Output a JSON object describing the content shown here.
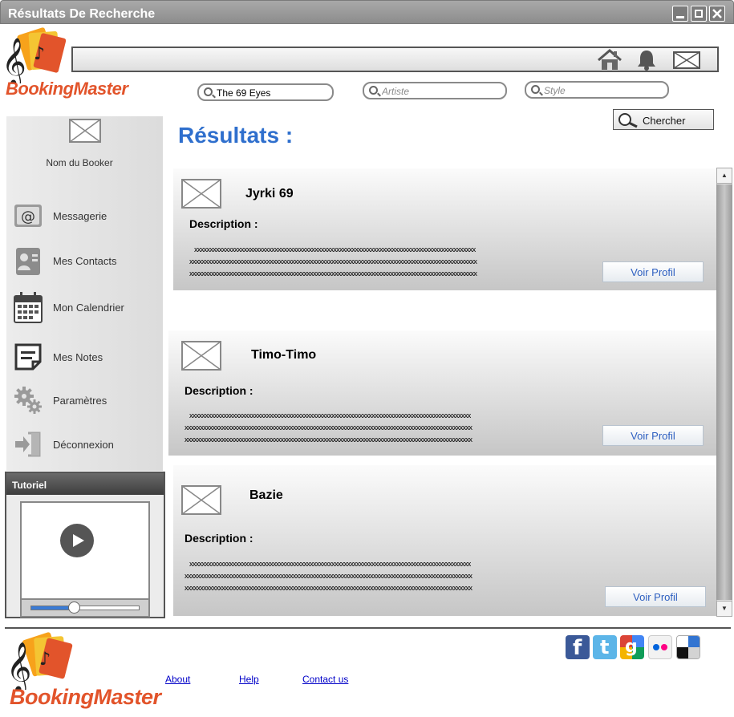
{
  "window": {
    "title": "Résultats De Recherche"
  },
  "logo": {
    "text": "BookingMaster"
  },
  "search": {
    "query_value": "The 69 Eyes",
    "artist_placeholder": "Artiste",
    "style_placeholder": "Style",
    "button_label": "Chercher"
  },
  "sidebar": {
    "booker_name": "Nom du Booker",
    "items": [
      {
        "label": "Messagerie"
      },
      {
        "label": "Mes Contacts"
      },
      {
        "label": "Mon Calendrier"
      },
      {
        "label": "Mes Notes"
      },
      {
        "label": "Paramètres"
      },
      {
        "label": "Déconnexion"
      }
    ]
  },
  "tutorial": {
    "title": "Tutoriel",
    "progress": 0.4
  },
  "results": {
    "title": "Résultats :",
    "items": [
      {
        "name": "Jyrki 69",
        "description_label": "Description :",
        "lines": [
          "xxxxxxxxxxxxxxxxxxxxxxxxxxxxxxxxxxxxxxxxxxxxxxxxxxxxxxxxxxxxxxxxxxxxxxxxxxxxxxxxxxxxxxxxxxx",
          "xxxxxxxxxxxxxxxxxxxxxxxxxxxxxxxxxxxxxxxxxxxxxxxxxxxxxxxxxxxxxxxxxxxxxxxxxxxxxxxxxxxxxxxxxxxxx",
          "xxxxxxxxxxxxxxxxxxxxxxxxxxxxxxxxxxxxxxxxxxxxxxxxxxxxxxxxxxxxxxxxxxxxxxxxxxxxxxxxxxxxxxxxxxxxx"
        ],
        "button_label": "Voir Profil"
      },
      {
        "name": "Timo-Timo",
        "description_label": "Description :",
        "lines": [
          "xxxxxxxxxxxxxxxxxxxxxxxxxxxxxxxxxxxxxxxxxxxxxxxxxxxxxxxxxxxxxxxxxxxxxxxxxxxxxxxxxxxxxxxxxxx",
          "xxxxxxxxxxxxxxxxxxxxxxxxxxxxxxxxxxxxxxxxxxxxxxxxxxxxxxxxxxxxxxxxxxxxxxxxxxxxxxxxxxxxxxxxxxxxx",
          "xxxxxxxxxxxxxxxxxxxxxxxxxxxxxxxxxxxxxxxxxxxxxxxxxxxxxxxxxxxxxxxxxxxxxxxxxxxxxxxxxxxxxxxxxxxxx"
        ],
        "button_label": "Voir Profil"
      },
      {
        "name": "Bazie",
        "description_label": "Description :",
        "lines": [
          "xxxxxxxxxxxxxxxxxxxxxxxxxxxxxxxxxxxxxxxxxxxxxxxxxxxxxxxxxxxxxxxxxxxxxxxxxxxxxxxxxxxxxxxxxxx",
          "xxxxxxxxxxxxxxxxxxxxxxxxxxxxxxxxxxxxxxxxxxxxxxxxxxxxxxxxxxxxxxxxxxxxxxxxxxxxxxxxxxxxxxxxxxxxx",
          "xxxxxxxxxxxxxxxxxxxxxxxxxxxxxxxxxxxxxxxxxxxxxxxxxxxxxxxxxxxxxxxxxxxxxxxxxxxxxxxxxxxxxxxxxxxxx"
        ],
        "button_label": "Voir Profil"
      }
    ]
  },
  "footer": {
    "links": [
      {
        "label": "About"
      },
      {
        "label": "Help"
      },
      {
        "label": "Contact us"
      }
    ],
    "social_icons": [
      "facebook-icon",
      "twitter-icon",
      "google-plus-icon",
      "flickr-icon",
      "delicious-icon"
    ]
  },
  "colors": {
    "accent": "#2f6fcd",
    "logo": "#e2542b",
    "link": "#0000c8"
  }
}
